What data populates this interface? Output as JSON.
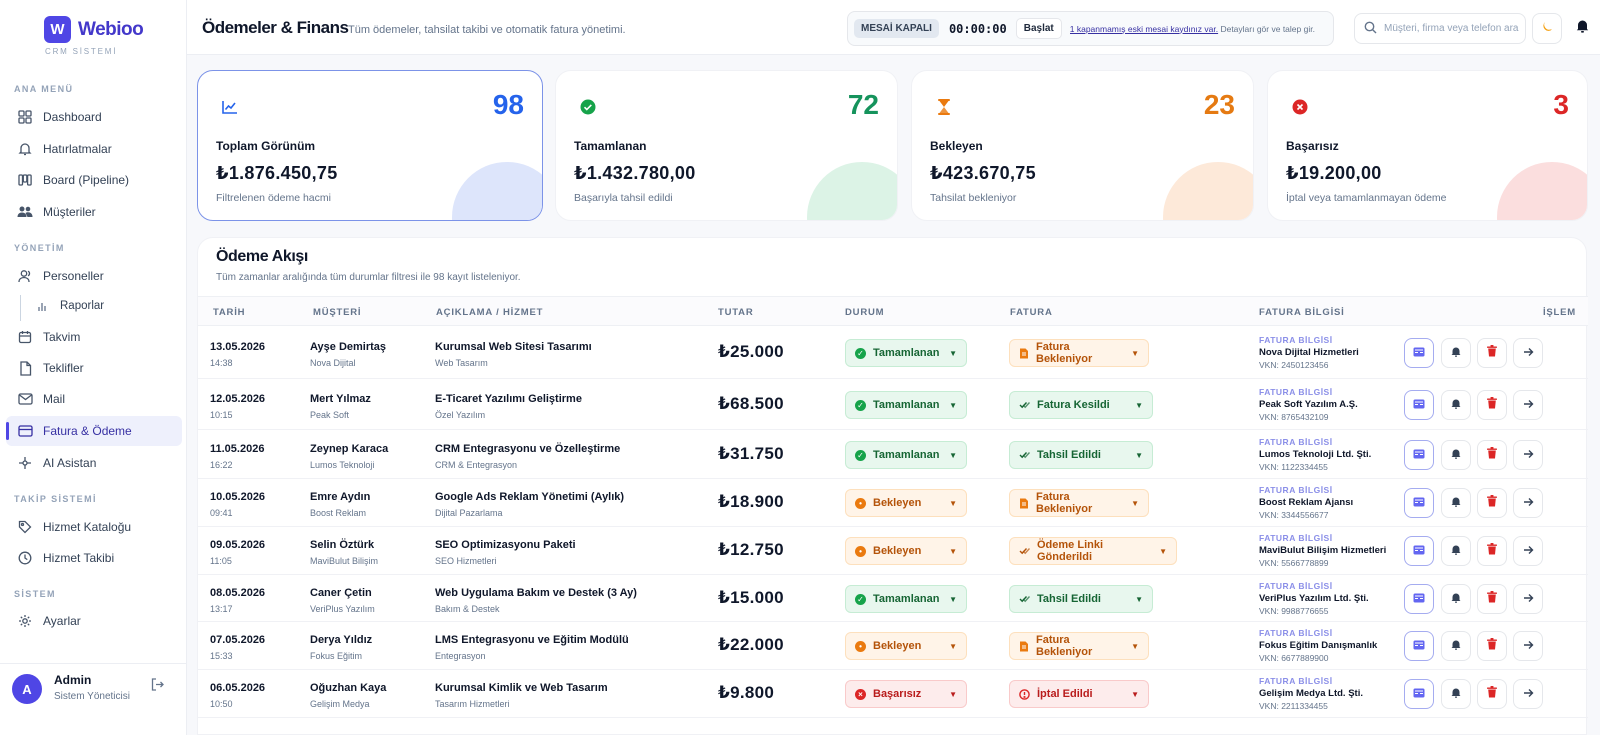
{
  "brand": {
    "initial": "W",
    "name": "Webioo",
    "subtitle": "CRM SİSTEMİ"
  },
  "sidebar": {
    "sections": [
      "ANA MENÜ",
      "YÖNETİM",
      "TAKİP SİSTEMİ",
      "SİSTEM"
    ],
    "items": [
      {
        "label": "Dashboard",
        "icon": "grid-icon"
      },
      {
        "label": "Hatırlatmalar",
        "icon": "bell-icon"
      },
      {
        "label": "Board (Pipeline)",
        "icon": "board-icon"
      },
      {
        "label": "Müşteriler",
        "icon": "users-icon"
      },
      {
        "label": "Personeller",
        "icon": "user-icon"
      },
      {
        "label": "Raporlar",
        "icon": "bar-chart-icon"
      },
      {
        "label": "Takvim",
        "icon": "calendar-icon"
      },
      {
        "label": "Teklifler",
        "icon": "document-icon"
      },
      {
        "label": "Mail",
        "icon": "mail-icon"
      },
      {
        "label": "Fatura & Ödeme",
        "icon": "card-icon"
      },
      {
        "label": "AI Asistan",
        "icon": "sparkle-icon"
      },
      {
        "label": "Hizmet Kataloğu",
        "icon": "tag-icon"
      },
      {
        "label": "Hizmet Takibi",
        "icon": "clock-icon"
      },
      {
        "label": "Ayarlar",
        "icon": "gear-icon"
      }
    ],
    "user": {
      "initial": "A",
      "name": "Admin",
      "role": "Sistem Yöneticisi"
    }
  },
  "header": {
    "title": "Ödemeler & Finans",
    "subtitle": "Tüm ödemeler, tahsilat takibi ve otomatik fatura yönetimi.",
    "shift_status": "MESAİ KAPALI",
    "shift_timer": "00:00:00",
    "shift_start": "Başlat",
    "shift_link": "1 kapanmamış eski mesai kaydınız var.",
    "shift_note": " Detayları gör ve talep gir.",
    "search_placeholder": "Müşteri, firma veya telefon ara"
  },
  "stats": [
    {
      "count": "98",
      "label": "Toplam Görünüm",
      "amount": "₺1.876.450,75",
      "desc": "Filtrelenen ödeme hacmi",
      "icon": "trend-chart-icon",
      "color": "#2563eb",
      "blob": "#dde5fb",
      "iconColor": "#2563eb"
    },
    {
      "count": "72",
      "label": "Tamamlanan",
      "amount": "₺1.432.780,00",
      "desc": "Başarıyla tahsil edildi",
      "icon": "check-circle-icon",
      "color": "#15935c",
      "blob": "#dcf3e6",
      "iconColor": "#16a34a"
    },
    {
      "count": "23",
      "label": "Bekleyen",
      "amount": "₺423.670,75",
      "desc": "Tahsilat bekleniyor",
      "icon": "hourglass-icon",
      "color": "#e57a12",
      "blob": "#fde9d9",
      "iconColor": "#ea7a0f"
    },
    {
      "count": "3",
      "label": "Başarısız",
      "amount": "₺19.200,00",
      "desc": "İptal veya tamamlanmayan ödeme",
      "icon": "x-circle-icon",
      "color": "#dc2626",
      "blob": "#fbdede",
      "iconColor": "#dc2626"
    }
  ],
  "payments": {
    "title": "Ödeme Akışı",
    "subtitle": "Tüm zamanlar aralığında tüm durumlar filtresi ile 98 kayıt listeleniyor.",
    "columns": [
      "TARİH",
      "MÜŞTERİ",
      "AÇIKLAMA / HİZMET",
      "TUTAR",
      "DURUM",
      "FATURA",
      "FATURA BİLGİSİ",
      "İŞLEM"
    ],
    "rows": [
      {
        "date": "13.05.2026",
        "time": "14:38",
        "customer": "Ayşe Demirtaş",
        "company": "Nova Dijital",
        "desc": "Kurumsal Web Sitesi Tasarımı",
        "category": "Web Tasarım",
        "amount": "₺25.000",
        "status": "Tamamlanan",
        "status_kind": "ok",
        "invoice": "Fatura Bekleniyor",
        "invoice_kind": "wait",
        "invoice_icon": "file-icon",
        "fb_label": "FATURA BİLGİSİ",
        "fb_company": "Nova Dijital Hizmetleri",
        "fb_vkn": "VKN: 2450123456"
      },
      {
        "date": "12.05.2026",
        "time": "10:15",
        "customer": "Mert Yılmaz",
        "company": "Peak Soft",
        "desc": "E-Ticaret Yazılımı Geliştirme",
        "category": "Özel Yazılım",
        "amount": "₺68.500",
        "status": "Tamamlanan",
        "status_kind": "ok",
        "invoice": "Fatura Kesildi",
        "invoice_kind": "ok",
        "invoice_icon": "double-check-icon",
        "fb_label": "FATURA BİLGİSİ",
        "fb_company": "Peak Soft Yazılım A.Ş.",
        "fb_vkn": "VKN: 8765432109"
      },
      {
        "date": "11.05.2026",
        "time": "16:22",
        "customer": "Zeynep Karaca",
        "company": "Lumos Teknoloji",
        "desc": "CRM Entegrasyonu ve Özelleştirme",
        "category": "CRM & Entegrasyon",
        "amount": "₺31.750",
        "status": "Tamamlanan",
        "status_kind": "ok",
        "invoice": "Tahsil Edildi",
        "invoice_kind": "ok",
        "invoice_icon": "double-check-icon",
        "fb_label": "FATURA BİLGİSİ",
        "fb_company": "Lumos Teknoloji Ltd. Şti.",
        "fb_vkn": "VKN: 1122334455"
      },
      {
        "date": "10.05.2026",
        "time": "09:41",
        "customer": "Emre Aydın",
        "company": "Boost Reklam",
        "desc": "Google Ads Reklam Yönetimi (Aylık)",
        "category": "Dijital Pazarlama",
        "amount": "₺18.900",
        "status": "Bekleyen",
        "status_kind": "wait",
        "invoice": "Fatura Bekleniyor",
        "invoice_kind": "wait",
        "invoice_icon": "file-icon",
        "fb_label": "FATURA BİLGİSİ",
        "fb_company": "Boost Reklam Ajansı",
        "fb_vkn": "VKN: 3344556677"
      },
      {
        "date": "09.05.2026",
        "time": "11:05",
        "customer": "Selin Öztürk",
        "company": "MaviBulut Bilişim",
        "desc": "SEO Optimizasyonu Paketi",
        "category": "SEO Hizmetleri",
        "amount": "₺12.750",
        "status": "Bekleyen",
        "status_kind": "wait",
        "invoice": "Ödeme Linki Gönderildi",
        "invoice_kind": "wait",
        "invoice_icon": "double-check-icon",
        "fb_label": "FATURA BİLGİSİ",
        "fb_company": "MaviBulut Bilişim Hizmetleri",
        "fb_vkn": "VKN: 5566778899"
      },
      {
        "date": "08.05.2026",
        "time": "13:17",
        "customer": "Caner Çetin",
        "company": "VeriPlus Yazılım",
        "desc": "Web Uygulama Bakım ve Destek (3 Ay)",
        "category": "Bakım & Destek",
        "amount": "₺15.000",
        "status": "Tamamlanan",
        "status_kind": "ok",
        "invoice": "Tahsil Edildi",
        "invoice_kind": "ok",
        "invoice_icon": "double-check-icon",
        "fb_label": "FATURA BİLGİSİ",
        "fb_company": "VeriPlus Yazılım Ltd. Şti.",
        "fb_vkn": "VKN: 9988776655"
      },
      {
        "date": "07.05.2026",
        "time": "15:33",
        "customer": "Derya Yıldız",
        "company": "Fokus Eğitim",
        "desc": "LMS Entegrasyonu ve Eğitim Modülü",
        "category": "Entegrasyon",
        "amount": "₺22.000",
        "status": "Bekleyen",
        "status_kind": "wait",
        "invoice": "Fatura Bekleniyor",
        "invoice_kind": "wait",
        "invoice_icon": "file-icon",
        "fb_label": "FATURA BİLGİSİ",
        "fb_company": "Fokus Eğitim Danışmanlık",
        "fb_vkn": "VKN: 6677889900"
      },
      {
        "date": "06.05.2026",
        "time": "10:50",
        "customer": "Oğuzhan Kaya",
        "company": "Gelişim Medya",
        "desc": "Kurumsal Kimlik ve Web Tasarım",
        "category": "Tasarım Hizmetleri",
        "amount": "₺9.800",
        "status": "Başarısız",
        "status_kind": "fail",
        "invoice": "İptal Edildi",
        "invoice_kind": "fail",
        "invoice_icon": "ban-icon",
        "fb_label": "FATURA BİLGİSİ",
        "fb_company": "Gelişim Medya Ltd. Şti.",
        "fb_vkn": "VKN: 2211334455"
      }
    ]
  }
}
